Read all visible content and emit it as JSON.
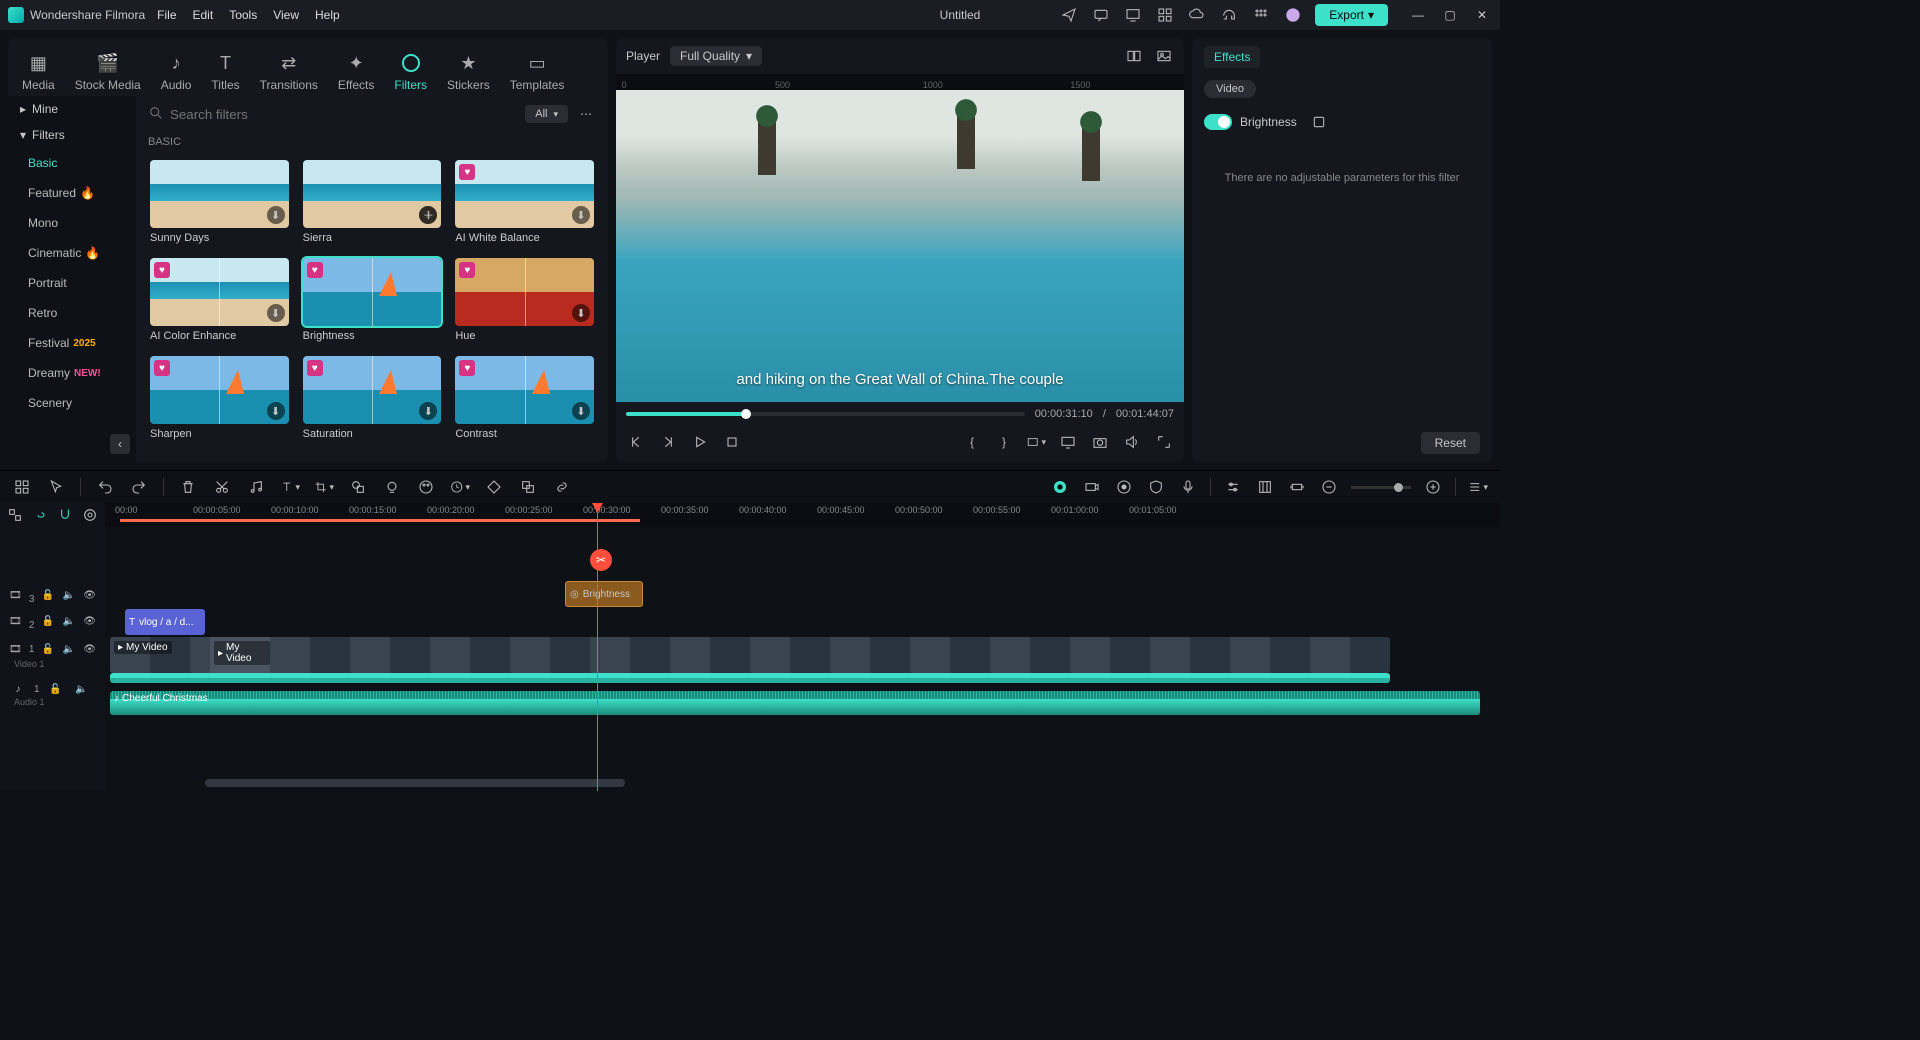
{
  "app": {
    "name": "Wondershare Filmora",
    "title": "Untitled"
  },
  "menu": [
    "File",
    "Edit",
    "Tools",
    "View",
    "Help"
  ],
  "export": "Export",
  "topTabs": [
    {
      "label": "Media"
    },
    {
      "label": "Stock Media"
    },
    {
      "label": "Audio"
    },
    {
      "label": "Titles"
    },
    {
      "label": "Transitions"
    },
    {
      "label": "Effects"
    },
    {
      "label": "Filters",
      "active": true
    },
    {
      "label": "Stickers"
    },
    {
      "label": "Templates"
    }
  ],
  "sidebar": {
    "groups": [
      {
        "label": "Mine",
        "icon": "▸"
      },
      {
        "label": "Filters",
        "icon": "▾"
      }
    ],
    "items": [
      {
        "label": "Basic",
        "active": true
      },
      {
        "label": "Featured",
        "badge": "fire"
      },
      {
        "label": "Mono"
      },
      {
        "label": "Cinematic",
        "badge": "fire"
      },
      {
        "label": "Portrait"
      },
      {
        "label": "Retro"
      },
      {
        "label": "Festival",
        "badge": "year",
        "badgeText": "2025"
      },
      {
        "label": "Dreamy",
        "badge": "new",
        "badgeText": "NEW!"
      },
      {
        "label": "Scenery"
      }
    ]
  },
  "search": {
    "placeholder": "Search filters"
  },
  "filterPill": "All",
  "category": "BASIC",
  "filters": [
    {
      "name": "Sunny Days",
      "t": "beach",
      "dl": true
    },
    {
      "name": "Sierra",
      "t": "beach",
      "dl": true,
      "add": true
    },
    {
      "name": "AI White Balance",
      "t": "beach",
      "heart": true,
      "dl": true
    },
    {
      "name": "AI Color Enhance",
      "t": "beach split",
      "heart": true,
      "dl": true
    },
    {
      "name": "Brightness",
      "t": "sail split",
      "heart": true,
      "selected": true
    },
    {
      "name": "Hue",
      "t": "hue-r split",
      "heart": true,
      "dl": true
    },
    {
      "name": "Sharpen",
      "t": "sail split",
      "heart": true,
      "dl": true
    },
    {
      "name": "Saturation",
      "t": "sail split",
      "heart": true,
      "dl": true
    },
    {
      "name": "Contrast",
      "t": "sail split",
      "heart": true,
      "dl": true
    }
  ],
  "player": {
    "label": "Player",
    "quality": "Full Quality",
    "subtitle": "and hiking on the Great Wall of China.The couple",
    "current": "00:00:31:10",
    "total": "00:01:44:07",
    "sep": "/",
    "rulerMarks": [
      {
        "v": "0",
        "p": 0
      },
      {
        "v": "500",
        "p": 27
      },
      {
        "v": "1000",
        "p": 54
      },
      {
        "v": "1500",
        "p": 80
      }
    ]
  },
  "rightPanel": {
    "tab": "Effects",
    "sub": "Video",
    "row": "Brightness",
    "msg": "There are no adjustable parameters for this filter",
    "reset": "Reset"
  },
  "timeline": {
    "marks": [
      "00:00",
      "00:00:05:00",
      "00:00:10:00",
      "00:00:15:00",
      "00:00:20:00",
      "00:00:25:00",
      "00:00:30:00",
      "00:00:35:00",
      "00:00:40:00",
      "00:00:45:00",
      "00:00:50:00",
      "00:00:55:00",
      "00:01:00:00",
      "00:01:05:00"
    ],
    "effectClip": "Brightness",
    "textClip": "vlog / a / d...",
    "videoClip": "My Video",
    "videoClip2": "My Video",
    "audioClip": "Cheerful Christmas",
    "tracks": [
      {
        "id": "3"
      },
      {
        "id": "2"
      },
      {
        "id": "1",
        "label": "Video 1"
      },
      {
        "id": "1",
        "label": "Audio 1",
        "audio": true
      }
    ]
  }
}
